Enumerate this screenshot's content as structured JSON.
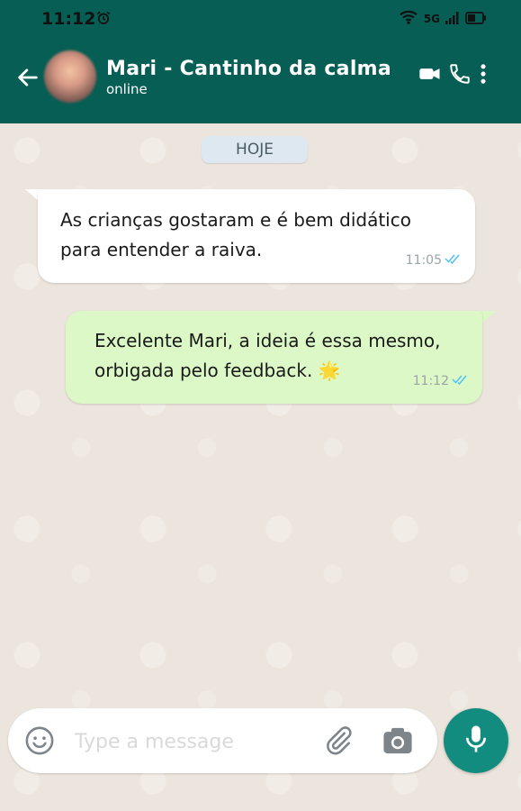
{
  "status_bar": {
    "time": "11:12",
    "network": "5G",
    "icons": [
      "alarm-icon",
      "wifi-icon",
      "signal-icon",
      "battery-icon"
    ]
  },
  "header": {
    "contact_name": "Mari - Cantinho da calma",
    "status": "online",
    "background_color": "#075e54",
    "icons": [
      "back-arrow-icon",
      "video-call-icon",
      "phone-icon",
      "more-vert-icon"
    ]
  },
  "chat": {
    "date_label": "HOJE",
    "messages": [
      {
        "direction": "incoming",
        "text": "As crianças gostaram e é bem didático para entender a raiva.",
        "time": "11:05"
      },
      {
        "direction": "outgoing",
        "text": "Excelente Mari, a ideia é essa mesmo, orbigada pelo feedback. 🌟",
        "time": "11:12"
      }
    ],
    "incoming_color": "#ffffff",
    "outgoing_color": "#dcf8c6",
    "tick_color": "#4fc3f7"
  },
  "composer": {
    "placeholder": "Type a message",
    "value": "",
    "icons": [
      "emoji-icon",
      "attach-icon",
      "camera-icon",
      "mic-icon"
    ],
    "mic_color": "#128c7e"
  }
}
